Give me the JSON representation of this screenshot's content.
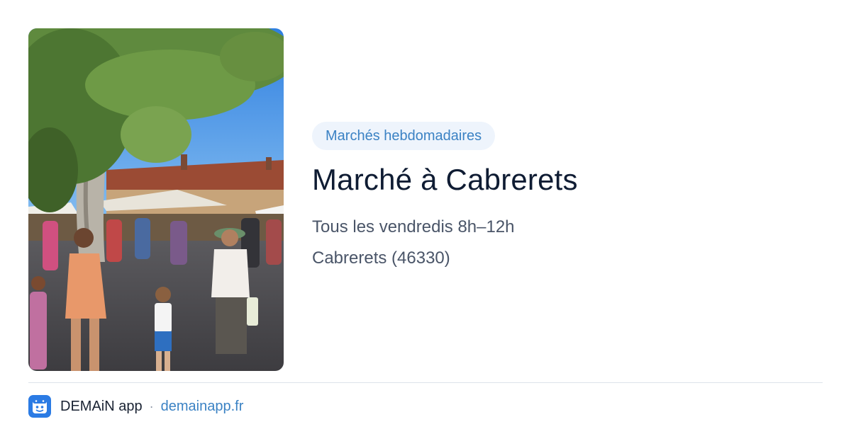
{
  "hero_image": {
    "alt": "market-scene-photo"
  },
  "category": {
    "label": "Marchés hebdomadaires",
    "color": "#3b82c4",
    "background": "#eef4fc"
  },
  "market": {
    "title": "Marché à Cabrerets",
    "schedule": "Tous les vendredis 8h–12h",
    "location": "Cabrerets (46330)"
  },
  "footer": {
    "app_icon": "demain-app-logo-icon",
    "app_name": "DEMAiN app",
    "separator": "·",
    "site": "demainapp.fr"
  },
  "colors": {
    "title": "#0f1c33",
    "body_text": "#4a5568",
    "link": "#3b82c4",
    "app_icon_bg": "#2b7be4",
    "divider": "#dde3ea"
  }
}
